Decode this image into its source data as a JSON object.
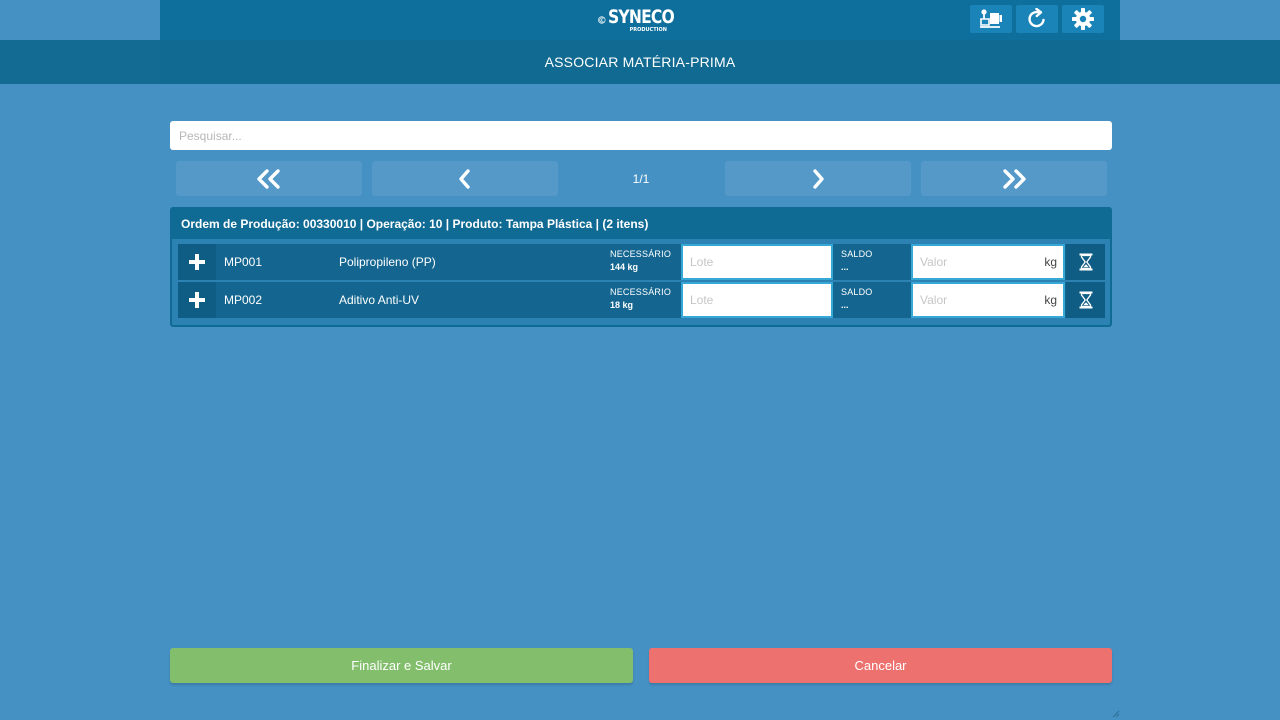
{
  "header": {
    "logo_text": "SYNECO",
    "logo_subtext": "PRODUCTION",
    "buttons": [
      {
        "name": "machine-transfer-icon"
      },
      {
        "name": "refresh-icon"
      },
      {
        "name": "gear-icon"
      }
    ]
  },
  "page": {
    "title": "ASSOCIAR MATÉRIA-PRIMA"
  },
  "search": {
    "placeholder": "Pesquisar...",
    "value": ""
  },
  "pagination": {
    "indicator": "1/1"
  },
  "group": {
    "header": "Ordem de Produção: 00330010 | Operação: 10 | Produto: Tampa Plástica | (2 itens)",
    "items": [
      {
        "code": "MP001",
        "name": "Polipropileno (PP)",
        "necessario_label": "NECESSÁRIO",
        "necessario_value": "144 kg",
        "lote_placeholder": "Lote",
        "saldo_label": "SALDO",
        "saldo_value": "...",
        "valor_placeholder": "Valor",
        "unit": "kg"
      },
      {
        "code": "MP002",
        "name": "Aditivo Anti-UV",
        "necessario_label": "NECESSÁRIO",
        "necessario_value": "18 kg",
        "lote_placeholder": "Lote",
        "saldo_label": "SALDO",
        "saldo_value": "...",
        "valor_placeholder": "Valor",
        "unit": "kg"
      }
    ]
  },
  "footer": {
    "finalize_label": "Finalizar e Salvar",
    "cancel_label": "Cancelar"
  },
  "colors": {
    "background": "#4591c4",
    "header": "#0e6f9c",
    "finalize": "#82be6b",
    "cancel": "#ed716e"
  }
}
